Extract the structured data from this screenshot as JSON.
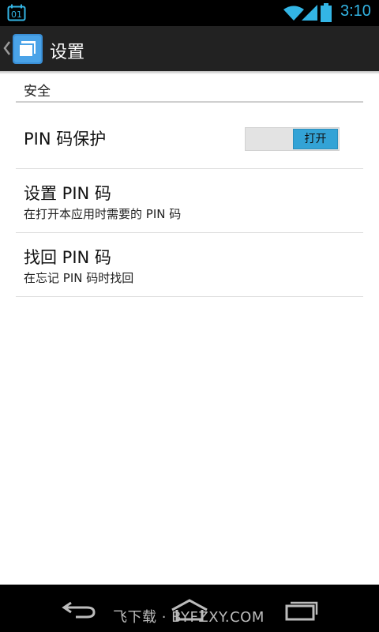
{
  "status_bar": {
    "calendar_day": "01",
    "time": "3:10",
    "icons": [
      "calendar-icon",
      "wifi-icon",
      "signal-icon",
      "battery-icon"
    ],
    "accent": "#33b5e5"
  },
  "action_bar": {
    "title": "设置",
    "icon": "app-icon"
  },
  "settings": {
    "section_header": "安全",
    "items": [
      {
        "title": "PIN 码保护",
        "toggle_label": "打开",
        "toggle_on": true
      },
      {
        "title": "设置 PIN 码",
        "summary": "在打开本应用时需要的 PIN 码"
      },
      {
        "title": "找回 PIN 码",
        "summary": "在忘记 PIN 码时找回"
      }
    ],
    "toggle_color": "#33a3d6"
  },
  "nav_bar": {
    "watermark": "飞下载 · BYFZXY.COM",
    "buttons": [
      "back-icon",
      "home-icon",
      "recents-icon"
    ]
  }
}
